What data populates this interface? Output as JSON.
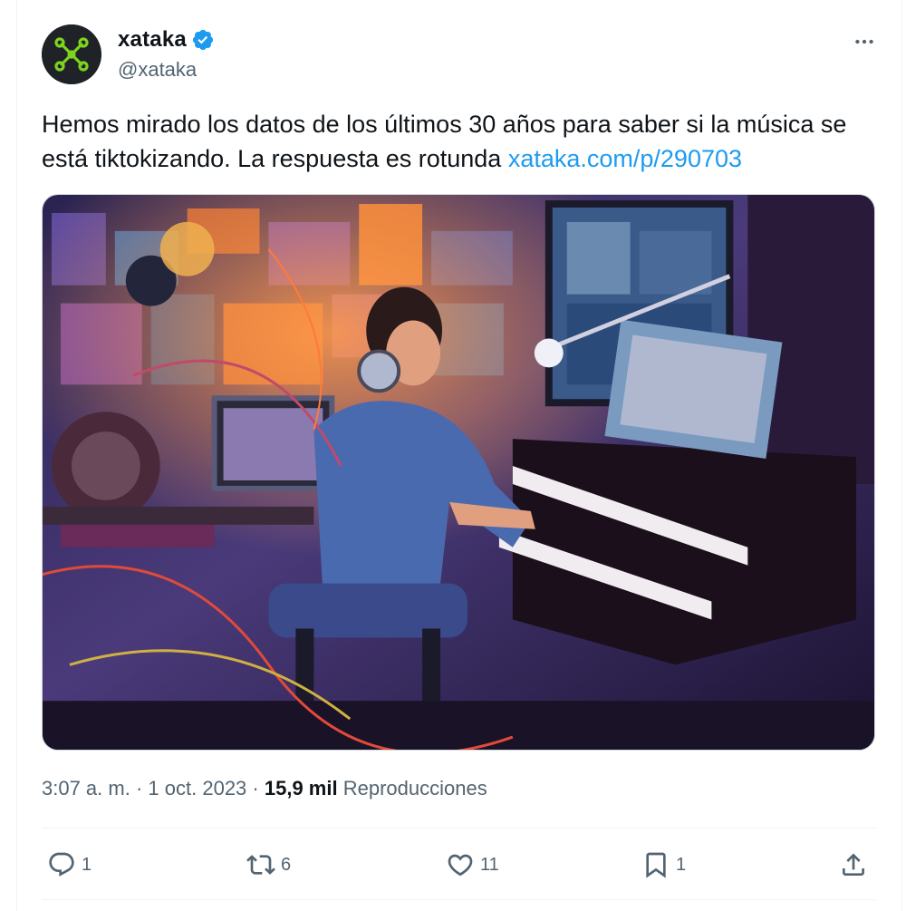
{
  "author": {
    "display_name": "xataka",
    "handle": "@xataka",
    "verified": true,
    "avatar_icon": "xataka-logo-icon",
    "avatar_bg": "#1f2327",
    "avatar_accent": "#7ed321"
  },
  "tweet": {
    "text": "Hemos mirado los datos de los últimos 30 años para saber si la música se está tiktokizando. La respuesta es rotunda ",
    "link": "xataka.com/p/290703",
    "link_color": "#1d9bf0"
  },
  "media": {
    "type": "image",
    "description_icon": "illustration-man-with-headphones-playing-piano-icon"
  },
  "meta": {
    "time": "3:07 a. m.",
    "separator": "·",
    "date": "1 oct. 2023",
    "views_count": "15,9 mil",
    "views_label": "Reproducciones"
  },
  "actions": {
    "replies": "1",
    "retweets": "6",
    "likes": "11",
    "bookmarks": "1"
  },
  "colors": {
    "text_primary": "#0f1419",
    "text_secondary": "#536471",
    "accent": "#1d9bf0",
    "border": "#eff3f4"
  }
}
